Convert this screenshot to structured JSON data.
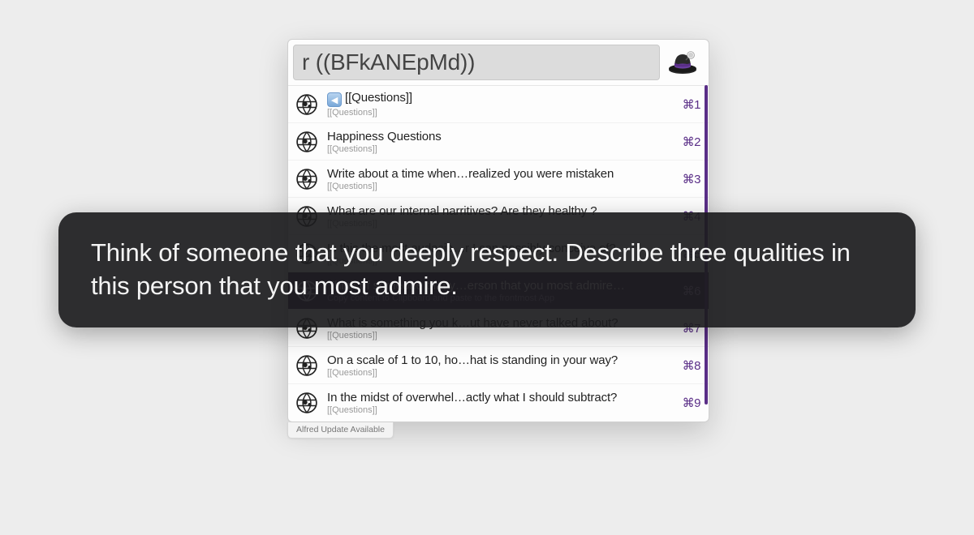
{
  "search": {
    "value": "r ((BFkANEpMd))"
  },
  "results": [
    {
      "arrow": true,
      "title": "[[Questions]]",
      "sub": "[[Questions]]",
      "key": "⌘1",
      "selected": false
    },
    {
      "arrow": false,
      "title": "Happiness Questions",
      "sub": "[[Questions]]",
      "key": "⌘2",
      "selected": false
    },
    {
      "arrow": false,
      "title": "Write about a time when…realized you were mistaken",
      "sub": "[[Questions]]",
      "key": "⌘3",
      "selected": false
    },
    {
      "arrow": false,
      "title": "What are our internal narritives? Are they healthy ?",
      "sub": "[[Questions]]",
      "key": "⌘4",
      "selected": false
    },
    {
      "arrow": false,
      "title": "Is this the most audacio…r I can possibly conceive of?",
      "sub": "[[Questions]]",
      "key": "⌘5",
      "selected": false
    },
    {
      "arrow": false,
      "title": "Think of someone that y…erson that you most admire…",
      "sub": "Copy content to Clipboard and paste to the frontmost App",
      "key": "⌘6",
      "selected": true
    },
    {
      "arrow": false,
      "title": "What is something you k…ut have never talked about?",
      "sub": "[[Questions]]",
      "key": "⌘7",
      "selected": false
    },
    {
      "arrow": false,
      "title": "On a scale of 1 to 10, ho…hat is standing in your way?",
      "sub": "[[Questions]]",
      "key": "⌘8",
      "selected": false
    },
    {
      "arrow": false,
      "title": "In the midst of overwhel…actly what I should subtract?",
      "sub": "[[Questions]]",
      "key": "⌘9",
      "selected": false
    }
  ],
  "update_text": "Alfred Update Available",
  "overlay_text": "Think of someone that you deeply respect. Describe three qualities in this person that you most admire.",
  "colors": {
    "accent": "#5a2e87"
  }
}
